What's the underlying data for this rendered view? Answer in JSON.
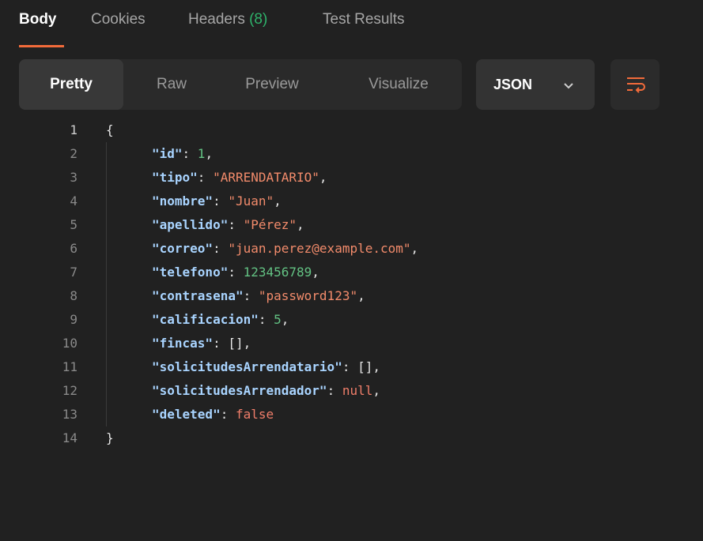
{
  "tabs": [
    {
      "label": "Body",
      "count": "",
      "active": true
    },
    {
      "label": "Cookies",
      "count": "",
      "active": false
    },
    {
      "label": "Headers",
      "count": "(8)",
      "active": false
    },
    {
      "label": "Test Results",
      "count": "",
      "active": false
    }
  ],
  "view_modes": [
    "Pretty",
    "Raw",
    "Preview",
    "Visualize"
  ],
  "active_view_mode": "Pretty",
  "format": {
    "selected": "JSON",
    "icon": "chevron-down-icon"
  },
  "wrap_icon": "wrap-lines-icon",
  "colors": {
    "accent": "#f26b3a",
    "count": "#2fb36b",
    "key": "#a9d4ff",
    "string": "#f28b6b",
    "number": "#63c283",
    "keyword": "#f07e6a"
  },
  "code_lines": [
    {
      "n": "1",
      "tokens": [
        {
          "t": "brace",
          "v": "{"
        }
      ]
    },
    {
      "n": "2",
      "tokens": [
        {
          "t": "key",
          "v": "\"id\""
        },
        {
          "t": "pun",
          "v": ": "
        },
        {
          "t": "num",
          "v": "1"
        },
        {
          "t": "pun",
          "v": ","
        }
      ]
    },
    {
      "n": "3",
      "tokens": [
        {
          "t": "key",
          "v": "\"tipo\""
        },
        {
          "t": "pun",
          "v": ": "
        },
        {
          "t": "str",
          "v": "\"ARRENDATARIO\""
        },
        {
          "t": "pun",
          "v": ","
        }
      ]
    },
    {
      "n": "4",
      "tokens": [
        {
          "t": "key",
          "v": "\"nombre\""
        },
        {
          "t": "pun",
          "v": ": "
        },
        {
          "t": "str",
          "v": "\"Juan\""
        },
        {
          "t": "pun",
          "v": ","
        }
      ]
    },
    {
      "n": "5",
      "tokens": [
        {
          "t": "key",
          "v": "\"apellido\""
        },
        {
          "t": "pun",
          "v": ": "
        },
        {
          "t": "str",
          "v": "\"Pérez\""
        },
        {
          "t": "pun",
          "v": ","
        }
      ]
    },
    {
      "n": "6",
      "tokens": [
        {
          "t": "key",
          "v": "\"correo\""
        },
        {
          "t": "pun",
          "v": ": "
        },
        {
          "t": "str",
          "v": "\"juan.perez@example.com\""
        },
        {
          "t": "pun",
          "v": ","
        }
      ]
    },
    {
      "n": "7",
      "tokens": [
        {
          "t": "key",
          "v": "\"telefono\""
        },
        {
          "t": "pun",
          "v": ": "
        },
        {
          "t": "num",
          "v": "123456789"
        },
        {
          "t": "pun",
          "v": ","
        }
      ]
    },
    {
      "n": "8",
      "tokens": [
        {
          "t": "key",
          "v": "\"contrasena\""
        },
        {
          "t": "pun",
          "v": ": "
        },
        {
          "t": "str",
          "v": "\"password123\""
        },
        {
          "t": "pun",
          "v": ","
        }
      ]
    },
    {
      "n": "9",
      "tokens": [
        {
          "t": "key",
          "v": "\"calificacion\""
        },
        {
          "t": "pun",
          "v": ": "
        },
        {
          "t": "num",
          "v": "5"
        },
        {
          "t": "pun",
          "v": ","
        }
      ]
    },
    {
      "n": "10",
      "tokens": [
        {
          "t": "key",
          "v": "\"fincas\""
        },
        {
          "t": "pun",
          "v": ": [],"
        }
      ]
    },
    {
      "n": "11",
      "tokens": [
        {
          "t": "key",
          "v": "\"solicitudesArrendatario\""
        },
        {
          "t": "pun",
          "v": ": [],"
        }
      ]
    },
    {
      "n": "12",
      "tokens": [
        {
          "t": "key",
          "v": "\"solicitudesArrendador\""
        },
        {
          "t": "pun",
          "v": ": "
        },
        {
          "t": "kw",
          "v": "null"
        },
        {
          "t": "pun",
          "v": ","
        }
      ]
    },
    {
      "n": "13",
      "tokens": [
        {
          "t": "key",
          "v": "\"deleted\""
        },
        {
          "t": "pun",
          "v": ": "
        },
        {
          "t": "kw",
          "v": "false"
        }
      ]
    },
    {
      "n": "14",
      "tokens": [
        {
          "t": "brace",
          "v": "}"
        }
      ]
    }
  ]
}
